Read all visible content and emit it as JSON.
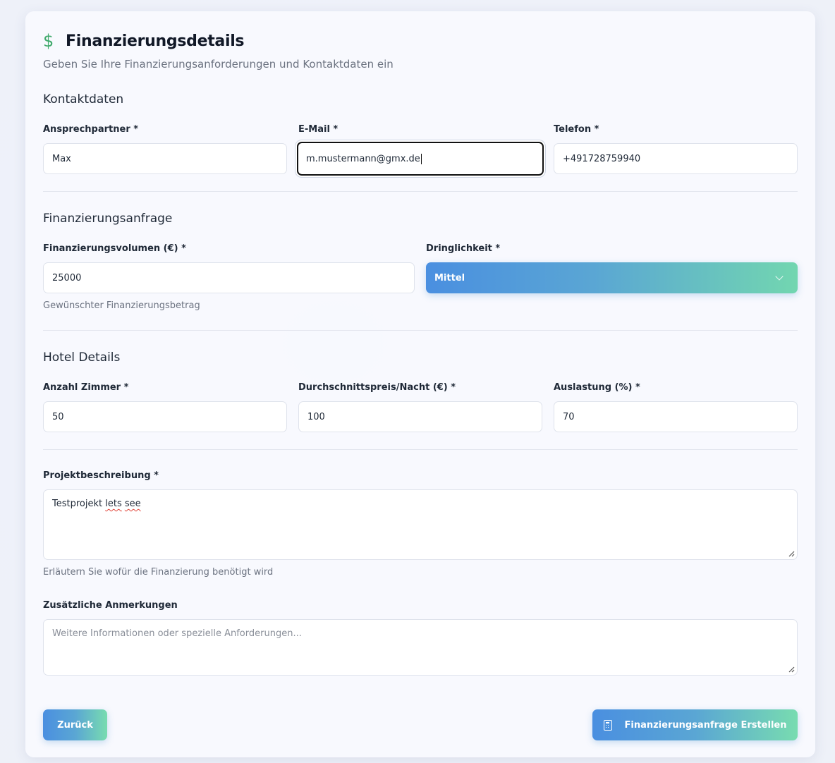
{
  "header": {
    "icon": "dollar-icon",
    "title": "Finanzierungsdetails",
    "subtitle": "Geben Sie Ihre Finanzierungsanforderungen und Kontaktdaten ein"
  },
  "contact": {
    "section_title": "Kontaktdaten",
    "person_label": "Ansprechpartner *",
    "person_value": "Max",
    "email_label": "E-Mail *",
    "email_value": "m.mustermann@gmx.de",
    "phone_label": "Telefon *",
    "phone_value": "+491728759940"
  },
  "financing": {
    "section_title": "Finanzierungsanfrage",
    "volume_label": "Finanzierungsvolumen (€) *",
    "volume_value": "25000",
    "volume_hint": "Gewünschter Finanzierungsbetrag",
    "urgency_label": "Dringlichkeit *",
    "urgency_value": "Mittel"
  },
  "hotel": {
    "section_title": "Hotel Details",
    "rooms_label": "Anzahl Zimmer *",
    "rooms_value": "50",
    "price_label": "Durchschnittspreis/Nacht (€) *",
    "price_value": "100",
    "occupancy_label": "Auslastung (%) *",
    "occupancy_value": "70"
  },
  "project": {
    "description_label": "Projektbeschreibung *",
    "description_value_part1": "Testprojekt ",
    "description_value_part2": "lets",
    "description_value_part3": " ",
    "description_value_part4": "see",
    "description_hint": "Erläutern Sie wofür die Finanzierung benötigt wird",
    "notes_label": "Zusätzliche Anmerkungen",
    "notes_placeholder": "Weitere Informationen oder spezielle Anforderungen..."
  },
  "actions": {
    "back_label": "Zurück",
    "submit_label": "Finanzierungsanfrage Erstellen",
    "submit_icon": "calculator-icon"
  },
  "colors": {
    "accent_gradient_start": "#4a8fe0",
    "accent_gradient_end": "#78dcb0",
    "dollar_icon": "#3fa96b"
  }
}
